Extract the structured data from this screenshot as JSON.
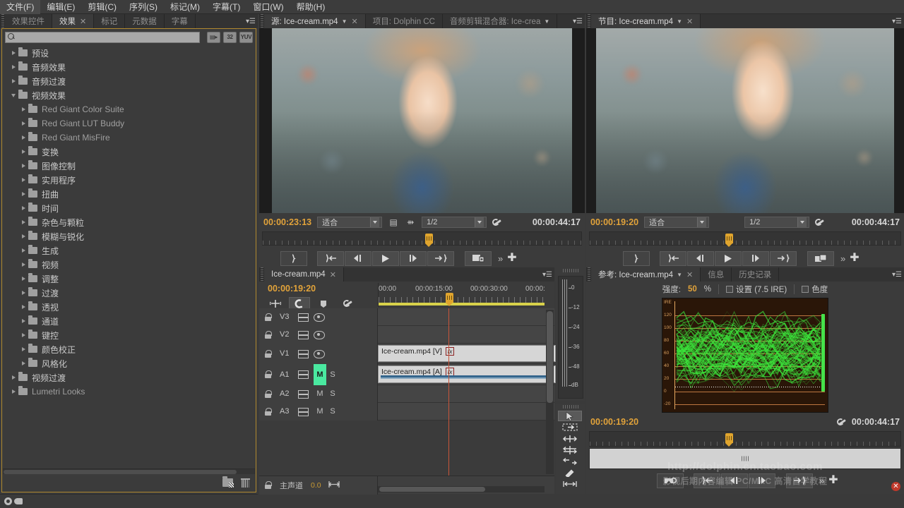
{
  "menu": {
    "items": [
      "文件(F)",
      "编辑(E)",
      "剪辑(C)",
      "序列(S)",
      "标记(M)",
      "字幕(T)",
      "窗口(W)",
      "帮助(H)"
    ]
  },
  "effects_panel": {
    "tabs": [
      {
        "label": "效果控件",
        "active": false,
        "closable": false
      },
      {
        "label": "效果",
        "active": true,
        "closable": true
      },
      {
        "label": "标记",
        "active": false,
        "closable": false
      },
      {
        "label": "元数据",
        "active": false,
        "closable": false
      },
      {
        "label": "字幕",
        "active": false,
        "closable": false
      }
    ],
    "search": {
      "value": "",
      "placeholder": ""
    },
    "filters": [
      {
        "name": "accelerated-effect-icon",
        "glyph": "▤▶"
      },
      {
        "name": "32-bit-color-icon",
        "glyph": "32"
      },
      {
        "name": "yuv-effect-icon",
        "glyph": "YUV"
      }
    ],
    "tree": [
      {
        "label": "预设",
        "level": 1,
        "expanded": false,
        "dim": false
      },
      {
        "label": "音频效果",
        "level": 1,
        "expanded": false,
        "dim": false
      },
      {
        "label": "音频过渡",
        "level": 1,
        "expanded": false,
        "dim": false
      },
      {
        "label": "视频效果",
        "level": 1,
        "expanded": true,
        "dim": false
      },
      {
        "label": "Red Giant Color Suite",
        "level": 2,
        "expanded": false,
        "dim": true
      },
      {
        "label": "Red Giant LUT Buddy",
        "level": 2,
        "expanded": false,
        "dim": true
      },
      {
        "label": "Red Giant MisFire",
        "level": 2,
        "expanded": false,
        "dim": true
      },
      {
        "label": "变换",
        "level": 2,
        "expanded": false,
        "dim": false
      },
      {
        "label": "图像控制",
        "level": 2,
        "expanded": false,
        "dim": false
      },
      {
        "label": "实用程序",
        "level": 2,
        "expanded": false,
        "dim": false
      },
      {
        "label": "扭曲",
        "level": 2,
        "expanded": false,
        "dim": false
      },
      {
        "label": "时间",
        "level": 2,
        "expanded": false,
        "dim": false
      },
      {
        "label": "杂色与颗粒",
        "level": 2,
        "expanded": false,
        "dim": false
      },
      {
        "label": "模糊与锐化",
        "level": 2,
        "expanded": false,
        "dim": false
      },
      {
        "label": "生成",
        "level": 2,
        "expanded": false,
        "dim": false
      },
      {
        "label": "视频",
        "level": 2,
        "expanded": false,
        "dim": false
      },
      {
        "label": "调整",
        "level": 2,
        "expanded": false,
        "dim": false
      },
      {
        "label": "过渡",
        "level": 2,
        "expanded": false,
        "dim": false
      },
      {
        "label": "透视",
        "level": 2,
        "expanded": false,
        "dim": false
      },
      {
        "label": "通道",
        "level": 2,
        "expanded": false,
        "dim": false
      },
      {
        "label": "键控",
        "level": 2,
        "expanded": false,
        "dim": false
      },
      {
        "label": "颜色校正",
        "level": 2,
        "expanded": false,
        "dim": false
      },
      {
        "label": "风格化",
        "level": 2,
        "expanded": false,
        "dim": false
      },
      {
        "label": "视频过渡",
        "level": 1,
        "expanded": false,
        "dim": false
      },
      {
        "label": "Lumetri Looks",
        "level": 1,
        "expanded": false,
        "dim": true
      }
    ]
  },
  "source_monitor": {
    "tabs": [
      {
        "label": "源: Ice-cream.mp4",
        "active": true,
        "closable": true,
        "dropdown": true
      },
      {
        "label": "项目: Dolphin CC",
        "active": false,
        "closable": false
      },
      {
        "label": "音频剪辑混合器: Ice-crea",
        "active": false,
        "closable": false,
        "dropdown": true
      }
    ],
    "current_time": "00:00:23:13",
    "duration": "00:00:44:17",
    "fit_label": "适合",
    "resolution_label": "1/2",
    "transport": [
      {
        "name": "mark-in-out-button",
        "glyph": "brace"
      },
      {
        "name": "go-to-in-point-button",
        "glyph": "prev-mark"
      },
      {
        "name": "step-back-button",
        "glyph": "step-back"
      },
      {
        "name": "play-stop-button",
        "glyph": "play"
      },
      {
        "name": "step-forward-button",
        "glyph": "step-fwd"
      },
      {
        "name": "go-to-out-point-button",
        "glyph": "next-mark"
      },
      {
        "name": "insert-button",
        "glyph": "insert"
      }
    ]
  },
  "program_monitor": {
    "tabs": [
      {
        "label": "节目: Ice-cream.mp4",
        "active": true,
        "closable": true,
        "dropdown": true
      }
    ],
    "current_time": "00:00:19:20",
    "duration": "00:00:44:17",
    "fit_label": "适合",
    "resolution_label": "1/2",
    "transport": [
      {
        "name": "mark-in-out-button",
        "glyph": "brace"
      },
      {
        "name": "go-to-in-point-button",
        "glyph": "prev-mark"
      },
      {
        "name": "step-back-button",
        "glyph": "step-back"
      },
      {
        "name": "play-stop-button",
        "glyph": "play"
      },
      {
        "name": "step-forward-button",
        "glyph": "step-fwd"
      },
      {
        "name": "go-to-out-point-button",
        "glyph": "next-mark"
      },
      {
        "name": "lift-button",
        "glyph": "lift"
      }
    ]
  },
  "timeline": {
    "tabs": [
      {
        "label": "Ice-cream.mp4",
        "active": true,
        "closable": true
      }
    ],
    "current_time": "00:00:19:20",
    "tools": [
      {
        "name": "snap-button",
        "active": false
      },
      {
        "name": "linked-selection-button",
        "active": true
      },
      {
        "name": "add-marker-button",
        "active": false
      },
      {
        "name": "timeline-settings-button",
        "active": false
      }
    ],
    "ruler_labels": [
      {
        "text": "00:00",
        "pos": 0
      },
      {
        "text": "00:00:15:00",
        "pos": 52
      },
      {
        "text": "00:00:30:00",
        "pos": 130
      },
      {
        "text": "00:00:",
        "pos": 208
      }
    ],
    "tracks": [
      {
        "name": "V3",
        "kind": "video",
        "clip": null
      },
      {
        "name": "V2",
        "kind": "video",
        "clip": null
      },
      {
        "name": "V1",
        "kind": "video",
        "clip": {
          "label": "Ice-cream.mp4 [V]",
          "fx": "fx"
        }
      },
      {
        "name": "A1",
        "kind": "audio",
        "mute": "M",
        "solo": "S",
        "mute_on": true,
        "clip": {
          "label": "Ice-cream.mp4 [A]",
          "fx": "fx"
        }
      },
      {
        "name": "A2",
        "kind": "audio",
        "mute": "M",
        "solo": "S",
        "mute_on": false,
        "clip": null
      },
      {
        "name": "A3",
        "kind": "audio",
        "mute": "M",
        "solo": "S",
        "mute_on": false,
        "clip": null
      }
    ],
    "master": {
      "label": "主声道",
      "value": "0.0"
    }
  },
  "audio_meter": {
    "scale": [
      "0",
      "-12",
      "-24",
      "-36",
      "-48",
      "dB"
    ]
  },
  "tools": [
    {
      "name": "selection-tool",
      "active": true
    },
    {
      "name": "track-select-tool",
      "active": false
    },
    {
      "name": "ripple-edit-tool",
      "active": false
    },
    {
      "name": "rolling-edit-tool",
      "active": false
    },
    {
      "name": "rate-stretch-tool",
      "active": false
    },
    {
      "name": "razor-tool",
      "active": false
    },
    {
      "name": "slip-tool",
      "active": false
    }
  ],
  "reference_panel": {
    "tabs": [
      {
        "label": "参考: Ice-cream.mp4",
        "active": true,
        "closable": true,
        "dropdown": true
      },
      {
        "label": "信息",
        "active": false,
        "closable": false
      },
      {
        "label": "历史记录",
        "active": false,
        "closable": false
      }
    ],
    "options": {
      "intensity_label": "强度:",
      "intensity_value": "50",
      "intensity_unit": "%",
      "setup_label": "设置 (7.5 IRE)",
      "setup_checked": false,
      "chroma_label": "色度",
      "chroma_checked": false
    },
    "current_time": "00:00:19:20",
    "duration": "00:00:44:17",
    "transport": [
      {
        "name": "export-frame-button",
        "glyph": "export"
      },
      {
        "name": "go-to-in-point-button",
        "glyph": "prev-mark"
      },
      {
        "name": "step-back-button",
        "glyph": "step-back"
      },
      {
        "name": "step-forward-button",
        "glyph": "step-fwd"
      },
      {
        "name": "go-to-out-point-button",
        "glyph": "next-mark"
      }
    ],
    "scope": {
      "type": "waveform-monitor",
      "unit": "IRE",
      "labels": [
        "IRE",
        "120",
        "100",
        "80",
        "60",
        "40",
        "20",
        "0",
        "-20"
      ]
    }
  },
  "watermark": {
    "line1": "http://dolphin.cn.taobao.com",
    "line2": "影视后期内容编辑 PC/MAC 高清自学教程"
  },
  "colors": {
    "accent_yellow": "#e2a33a",
    "panel_bg": "#3b3b3b",
    "focus_border": "#b0892f",
    "mute_green": "#4ae9a0",
    "playhead_red": "#c8553a",
    "scope_green": "#46e24a",
    "scope_bg": "#2a1608"
  }
}
